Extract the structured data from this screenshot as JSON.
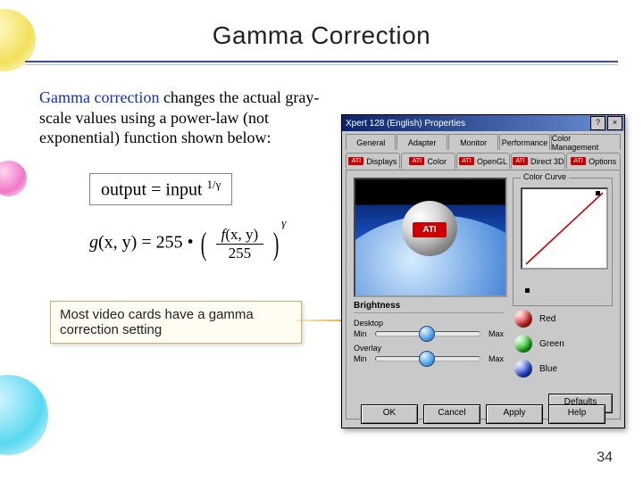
{
  "title": "Gamma Correction",
  "intro": {
    "term": "Gamma correction",
    "rest": " changes the actual gray-scale values using a power-law (not exponential) function shown below:"
  },
  "formula": {
    "lhs": "output",
    "rhs": "input",
    "exp": "1/γ"
  },
  "equation": {
    "g": "g",
    "args": "(x, y)",
    "const": "255",
    "f": "f",
    "den": "255",
    "pow": "γ"
  },
  "caption": "Most video cards have a gamma correction setting",
  "page_number": "34",
  "dialog": {
    "title": "Xpert 128 (English) Properties",
    "winbtns": {
      "help": "?",
      "close": "×"
    },
    "tabs_row1": [
      "General",
      "Adapter",
      "Monitor",
      "Performance",
      "Color Management"
    ],
    "tabs_row2": [
      "Displays",
      "Color",
      "OpenGL",
      "Direct 3D",
      "Options"
    ],
    "active_tab_index": 1,
    "preview_logo": "ATI",
    "curve": {
      "label": "Color Curve"
    },
    "rgb": [
      {
        "name": "Red",
        "color": "#d00018"
      },
      {
        "name": "Green",
        "color": "#18c018"
      },
      {
        "name": "Blue",
        "color": "#1838d8"
      }
    ],
    "brightness": {
      "label": "Brightness",
      "sections": [
        "Desktop",
        "Overlay"
      ],
      "min": "Min",
      "max": "Max",
      "desktop_pos": 0.48,
      "overlay_pos": 0.48
    },
    "defaults": "Defaults",
    "buttons": [
      "OK",
      "Cancel",
      "Apply",
      "Help"
    ]
  }
}
